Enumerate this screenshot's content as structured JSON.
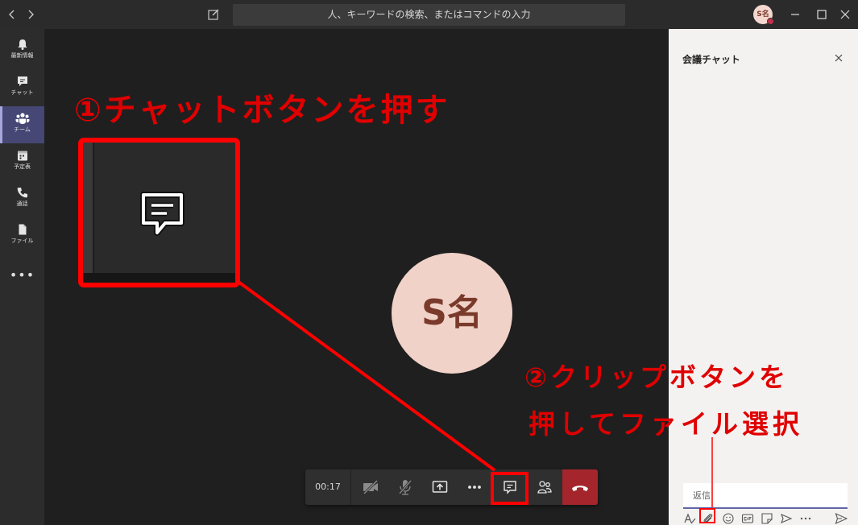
{
  "topbar": {
    "back_icon": "chevron-left-icon",
    "forward_icon": "chevron-right-icon",
    "search_placeholder": "人、キーワードの検索、またはコマンドの入力",
    "avatar_initials": "S名"
  },
  "rail": {
    "items": [
      {
        "label": "最新情報",
        "icon": "bell-icon"
      },
      {
        "label": "チャット",
        "icon": "chat-icon"
      },
      {
        "label": "チーム",
        "icon": "teams-icon"
      },
      {
        "label": "予定表",
        "icon": "calendar-icon"
      },
      {
        "label": "通話",
        "icon": "phone-icon"
      },
      {
        "label": "ファイル",
        "icon": "file-icon"
      }
    ],
    "more": "•••"
  },
  "stage": {
    "participant_initials": "S名"
  },
  "callbar": {
    "timer": "00:17",
    "more": "•••"
  },
  "chat_panel": {
    "title": "会議チャット",
    "reply_placeholder": "返信"
  },
  "annotations": {
    "step1": "①チャットボタンを押す",
    "step2_line1": "②クリップボタンを",
    "step2_line2": "押してファイル選択"
  },
  "colors": {
    "accent": "#6264a7",
    "annotation": "#ff0000",
    "hangup": "#a4262c",
    "avatar_bg": "#f1d2c9"
  }
}
